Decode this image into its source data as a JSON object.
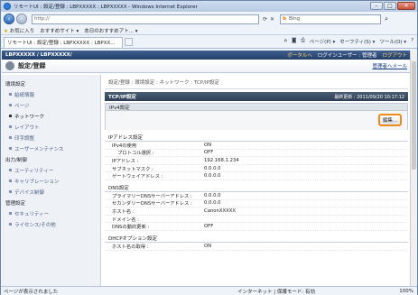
{
  "window": {
    "title": "リモートUI : 設定/登録 : LBPXXXXX : LBPXXXXX - Windows Internet Explorer",
    "min": "–",
    "max": "□",
    "close": "✕"
  },
  "address": {
    "url": "http://",
    "search": "Bing"
  },
  "favorites": {
    "label": "お気に入り",
    "item1": "おすすめサイト ▾",
    "item2": "本日のおすすめアト... ▾"
  },
  "tab": {
    "label": "リモートUI : 設定/登録 : LBPXXXXX : LBPXX..."
  },
  "commands": {
    "page": "ページ(P) ▾",
    "safety": "セーフティ(S) ▾",
    "tools": "ツール(O) ▾"
  },
  "banner": {
    "device": "LBPXXXXX / LBPXXXXX/",
    "portal": "ポータルへ",
    "user": "ログインユーザー : 管理者",
    "logout": "ログアウト"
  },
  "header": {
    "title": "設定/登録",
    "manage": "管理者へメール"
  },
  "sidebar": {
    "groups": [
      {
        "label": "環境設定",
        "items": [
          "給紙情報",
          "ページ",
          "ネットワーク",
          "レイアウト",
          "印字調整",
          "ユーザーメンテナンス"
        ]
      },
      {
        "label": "出力/制御",
        "items": [
          "ユーティリティー",
          "キャリブレーション",
          "デバイス制御"
        ]
      },
      {
        "label": "管理設定",
        "items": [
          "セキュリティー",
          "ライセンス/その他"
        ]
      }
    ]
  },
  "main": {
    "breadcrumb": "設定/登録 : 環境設定 : ネットワーク : TCP/IP設定",
    "page_title": "TCP/IP設定",
    "updated": "最終更新 : 2011/09/20 10:17:12",
    "ipv4": "IPv4設定",
    "edit": "編集...",
    "ip_section": "IPアドレス設定",
    "ip_rows": [
      {
        "k": "IPv4の使用",
        "v": "ON",
        "ind": false
      },
      {
        "k": "プロトコル選択 :",
        "v": "OFF",
        "ind": true
      },
      {
        "k": "IPアドレス :",
        "v": "192.168.1.234",
        "ind": false
      },
      {
        "k": "サブネットマスク :",
        "v": "0.0.0.0",
        "ind": false
      },
      {
        "k": "ゲートウェイアドレス :",
        "v": "0.0.0.0",
        "ind": false
      }
    ],
    "dns_section": "DNS設定",
    "dns_rows": [
      {
        "k": "プライマリーDNSサーバーアドレス :",
        "v": "0.0.0.0"
      },
      {
        "k": "セカンダリーDNSサーバーアドレス :",
        "v": "0.0.0.0"
      },
      {
        "k": "ホスト名 :",
        "v": "CanonXXXXX"
      },
      {
        "k": "ドメイン名 :",
        "v": ""
      },
      {
        "k": "DNSの動的更新 :",
        "v": "OFF"
      }
    ],
    "dhcp_section": "DHCPオプション設定",
    "dhcp_rows": [
      {
        "k": "ホスト名の取得 :",
        "v": "ON"
      }
    ]
  },
  "status": {
    "left": "ページが表示されました",
    "zone": "インターネット | 保護モード: 有効",
    "zoom": "100%"
  }
}
